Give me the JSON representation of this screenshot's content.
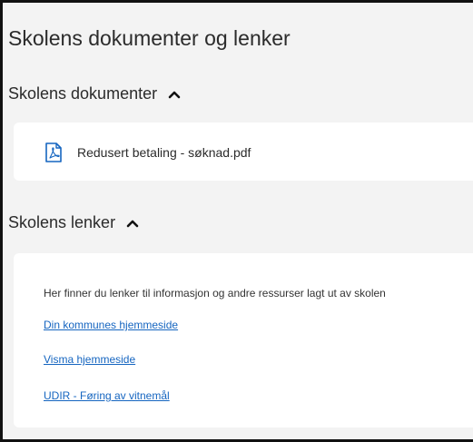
{
  "page": {
    "title": "Skolens dokumenter og lenker"
  },
  "documents_section": {
    "header": "Skolens dokumenter",
    "items": [
      {
        "label": "Redusert betaling - søknad.pdf",
        "icon": "pdf-file-icon"
      }
    ]
  },
  "links_section": {
    "header": "Skolens lenker",
    "intro": "Her finner du lenker til informasjon og andre ressurser lagt ut av skolen",
    "links": [
      {
        "label": "Din kommunes hjemmeside"
      },
      {
        "label": "Visma hjemmeside"
      },
      {
        "label": "UDIR - Føring av vitnemål"
      }
    ]
  },
  "colors": {
    "panel_bg": "#f3f3f3",
    "card_bg": "#ffffff",
    "link": "#1565c0",
    "pdf_icon": "#1565c0",
    "text": "#2b2b2b"
  }
}
